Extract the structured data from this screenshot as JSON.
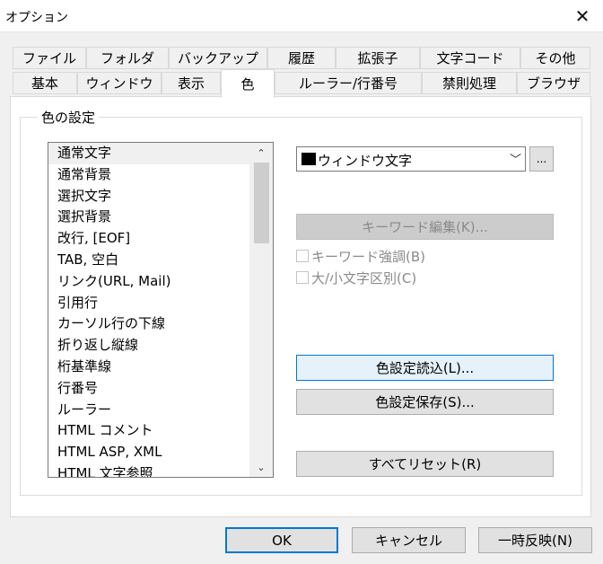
{
  "window": {
    "title": "オプション",
    "close_glyph": "✕"
  },
  "tabs_row1": [
    "ファイル",
    "フォルダ",
    "バックアップ",
    "履歴",
    "拡張子",
    "文字コード",
    "その他"
  ],
  "tabs_row2": [
    "基本",
    "ウィンドウ",
    "表示",
    "色",
    "ルーラー/行番号",
    "禁則処理",
    "ブラウザ"
  ],
  "active_tab": "色",
  "group": {
    "label": "色の設定"
  },
  "color_list": {
    "items": [
      "通常文字",
      "通常背景",
      "選択文字",
      "選択背景",
      "改行, [EOF]",
      "TAB, 空白",
      "リンク(URL, Mail)",
      "引用行",
      "カーソル行の下線",
      "折り返し縦線",
      "桁基準線",
      "行番号",
      "ルーラー",
      "HTML コメント",
      "HTML ASP, XML",
      "HTML 文字参照"
    ],
    "selected": "通常文字"
  },
  "scroll": {
    "up_glyph": "⌃",
    "down_glyph": "⌄"
  },
  "color_combo": {
    "value": "ウィンドウ文字",
    "swatch_color": "#000000",
    "arrow_glyph": "﹀"
  },
  "browse_button": "...",
  "keyword_button": "キーワード編集(K)...",
  "checkboxes": [
    {
      "label": "キーワード強調(B)",
      "checked": false,
      "enabled": false
    },
    {
      "label": "大/小文字区別(C)",
      "checked": false,
      "enabled": false
    }
  ],
  "buttons": {
    "load": "色設定読込(L)...",
    "save": "色設定保存(S)...",
    "reset": "すべてリセット(R)"
  },
  "footer": {
    "ok": "OK",
    "cancel": "キャンセル",
    "apply": "一時反映(N)"
  }
}
